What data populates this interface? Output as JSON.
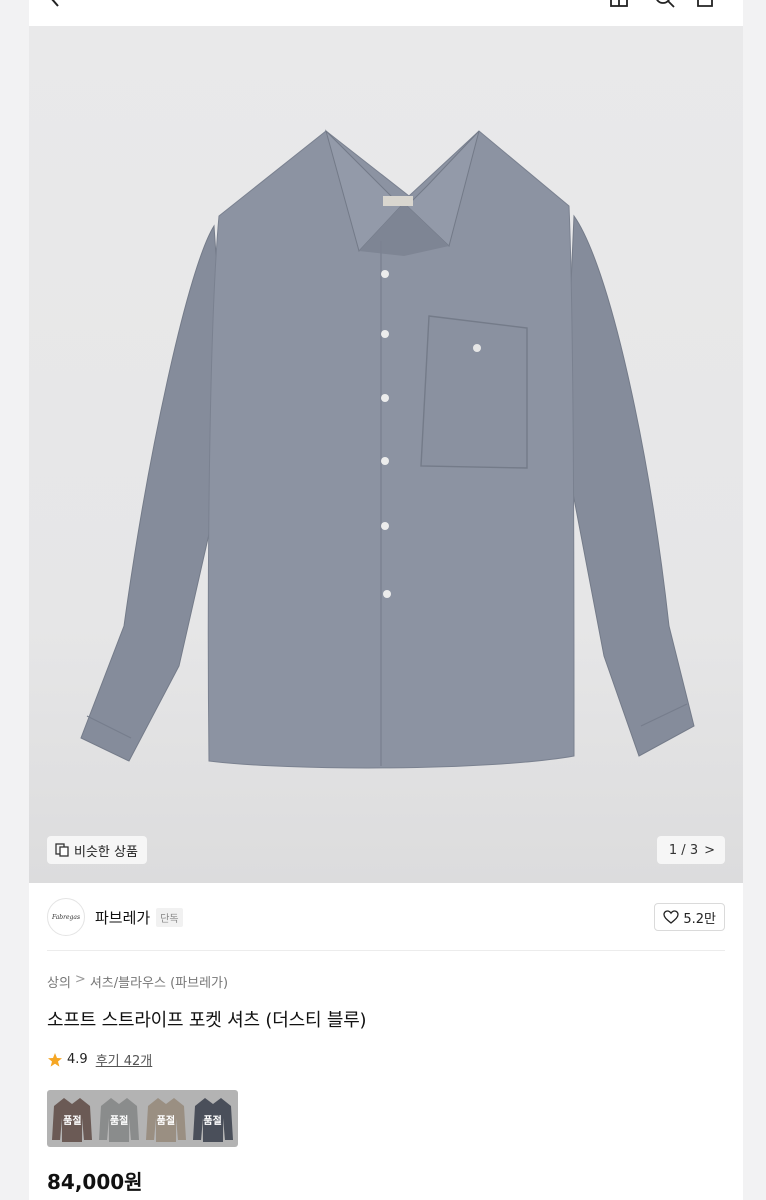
{
  "header": {
    "icons": [
      "back-icon",
      "share-icon",
      "search-icon",
      "cart-icon"
    ]
  },
  "gallery": {
    "similar_label": "비슷한 상품",
    "pager_text": "1 / 3",
    "pager_arrow": ">",
    "shirt_color": "#8c93a2"
  },
  "brand": {
    "logo_text": "Fabregas",
    "name": "파브레가",
    "tag": "단독",
    "likes": "5.2만"
  },
  "breadcrumb": {
    "items": [
      "상의",
      "셔츠/블라우스 (파브레가)"
    ],
    "separator": ">"
  },
  "product": {
    "title": "소프트 스트라이프 포켓 셔츠 (더스티 블루)",
    "rating": "4.9",
    "reviews": "후기 42개",
    "price": "84,000원",
    "rating_color": "#f5a623"
  },
  "swatches": [
    {
      "color": "#6b5a55",
      "label": "품절"
    },
    {
      "color": "#8a8c8c",
      "label": "품절"
    },
    {
      "color": "#9a8f82",
      "label": "품절"
    },
    {
      "color": "#4a4f5a",
      "label": "품절"
    }
  ]
}
